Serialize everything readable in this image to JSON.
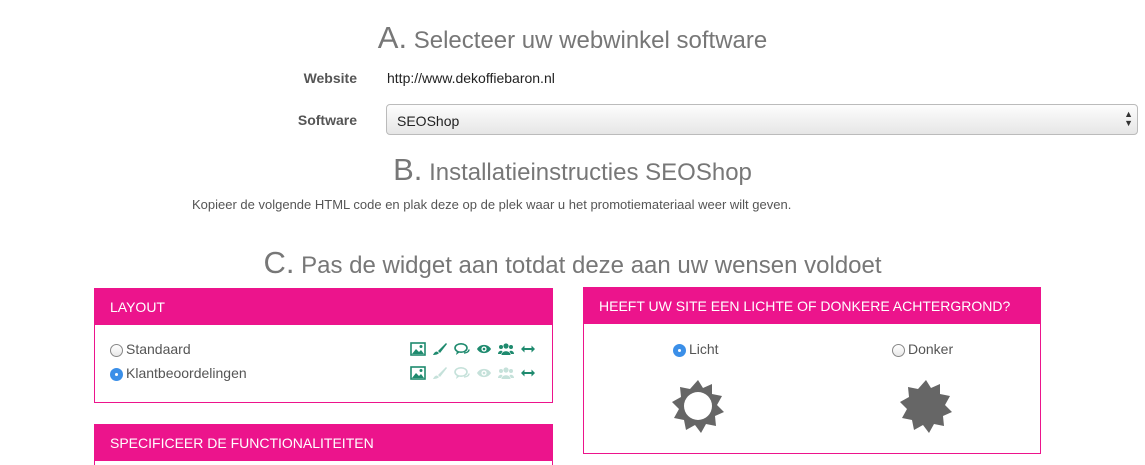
{
  "sectionA": {
    "letter": "A.",
    "title": "Selecteer uw webwinkel software"
  },
  "website": {
    "label": "Website",
    "value": "http://www.dekoffiebaron.nl"
  },
  "software": {
    "label": "Software",
    "selected": "SEOShop"
  },
  "sectionB": {
    "letter": "B.",
    "title": "Installatieinstructies SEOShop",
    "instruction": "Kopieer de volgende HTML code en plak deze op de plek waar u het promotiemateriaal weer wilt geven."
  },
  "sectionC": {
    "letter": "C.",
    "title": "Pas de widget aan totdat deze aan uw wensen voldoet"
  },
  "layoutPanel": {
    "title": "LAYOUT",
    "options": [
      {
        "label": "Standaard",
        "checked": false
      },
      {
        "label": "Klantbeoordelingen",
        "checked": true
      }
    ]
  },
  "backgroundPanel": {
    "title": "HEEFT UW SITE EEN LICHTE OF DONKERE ACHTERGROND?",
    "options": [
      {
        "label": "Licht",
        "checked": true
      },
      {
        "label": "Donker",
        "checked": false
      }
    ]
  },
  "functionPanel": {
    "title": "SPECIFICEER DE FUNCTIONALITEITEN"
  },
  "colors": {
    "accent": "#ec148c",
    "iconGreen": "#1e8a6e",
    "sunGray": "#666666",
    "radioBlue": "#3b8fe8"
  },
  "icons": [
    "image-icon",
    "brush-icon",
    "comments-icon",
    "eye-icon",
    "users-icon",
    "arrows-horizontal-icon"
  ]
}
